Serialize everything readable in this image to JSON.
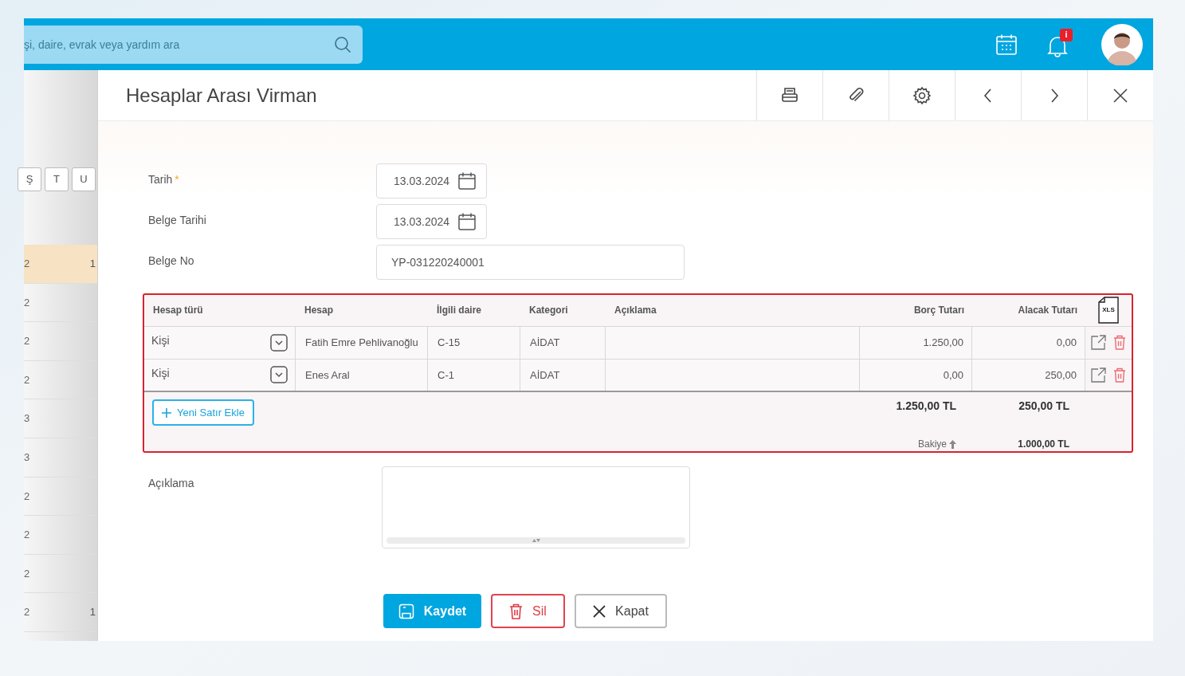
{
  "search": {
    "placeholder": "şi, daire, evrak veya yardım ara"
  },
  "notifications": {
    "badge": "i"
  },
  "background_list": {
    "toolbar": [
      "Ş",
      "T",
      "U"
    ],
    "rows": [
      {
        "column_1": "2",
        "column_2": "1",
        "selected": true
      },
      {
        "column_1": "2",
        "selected": false
      },
      {
        "column_1": "2",
        "selected": false
      },
      {
        "column_1": "2",
        "selected": false
      },
      {
        "column_1": "3",
        "selected": false
      },
      {
        "column_1": "3",
        "selected": false
      },
      {
        "column_1": "2",
        "selected": false
      },
      {
        "column_1": "2",
        "selected": false
      },
      {
        "column_1": "2",
        "selected": false
      },
      {
        "column_1": "2",
        "column_2": "1",
        "selected": false
      }
    ]
  },
  "modal": {
    "title": "Hesaplar Arası Virman",
    "fields": [
      {
        "kind": "date",
        "label": "Tarih",
        "required_mark": "*",
        "value": "13.03.2024"
      },
      {
        "kind": "date",
        "label": "Belge Tarihi",
        "value": "13.03.2024"
      },
      {
        "kind": "text",
        "label": "Belge No",
        "value": "YP-031220240001"
      }
    ],
    "table": {
      "columns": [
        "Hesap türü",
        "Hesap",
        "İlgili daire",
        "Kategori",
        "Açıklama",
        "Borç Tutarı",
        "Alacak Tutarı"
      ],
      "export_label": "XLS",
      "rows": [
        {
          "hesap_turu": "Kişi",
          "hesap": "Fatih Emre Pehlivanoğlu",
          "ilgili_daire": "C-15",
          "kategori": "AİDAT",
          "borc": "1.250,00",
          "alacak": "0,00"
        },
        {
          "hesap_turu": "Kişi",
          "hesap": "Enes Aral",
          "ilgili_daire": "C-1",
          "kategori": "AİDAT",
          "borc": "0,00",
          "alacak": "250,00"
        }
      ],
      "add_row_button": "Yeni Satır Ekle",
      "totals": {
        "borc": "1.250,00 TL",
        "alacak": "250,00 TL"
      },
      "balance": {
        "label": "Bakiye",
        "value": "1.000,00 TL"
      }
    },
    "description": {
      "label": "Açıklama"
    },
    "buttons": [
      {
        "kind": "save",
        "label": "Kaydet"
      },
      {
        "kind": "delete",
        "label": "Sil"
      },
      {
        "kind": "close",
        "label": "Kapat"
      }
    ]
  }
}
